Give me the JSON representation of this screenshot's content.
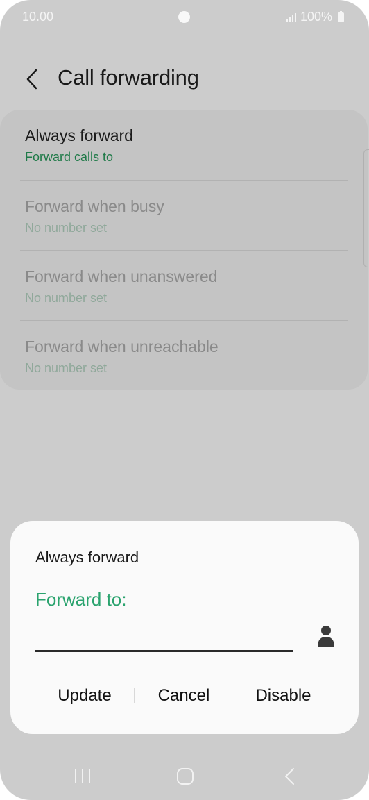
{
  "status_bar": {
    "time": "10.00",
    "battery_text": "100%"
  },
  "header": {
    "title": "Call forwarding"
  },
  "forwarding_options": [
    {
      "title": "Always forward",
      "subtitle": "Forward calls to"
    },
    {
      "title": "Forward when busy",
      "subtitle": "No number set"
    },
    {
      "title": "Forward when unanswered",
      "subtitle": "No number set"
    },
    {
      "title": "Forward when unreachable",
      "subtitle": "No number set"
    }
  ],
  "dialog": {
    "title": "Always forward",
    "field_label": "Forward to:",
    "input_value": "",
    "buttons": {
      "update": "Update",
      "cancel": "Cancel",
      "disable": "Disable"
    }
  },
  "colors": {
    "accent_green": "#2aa36e",
    "active_subtitle_green": "#1f7a48",
    "disabled_text": "#8a8a8a",
    "disabled_subtitle": "#8fa89a"
  },
  "icons": {
    "back": "back-arrow-icon",
    "contact": "contact-person-icon",
    "recents": "recent-apps-icon",
    "home": "home-icon",
    "nav_back": "nav-back-icon"
  }
}
